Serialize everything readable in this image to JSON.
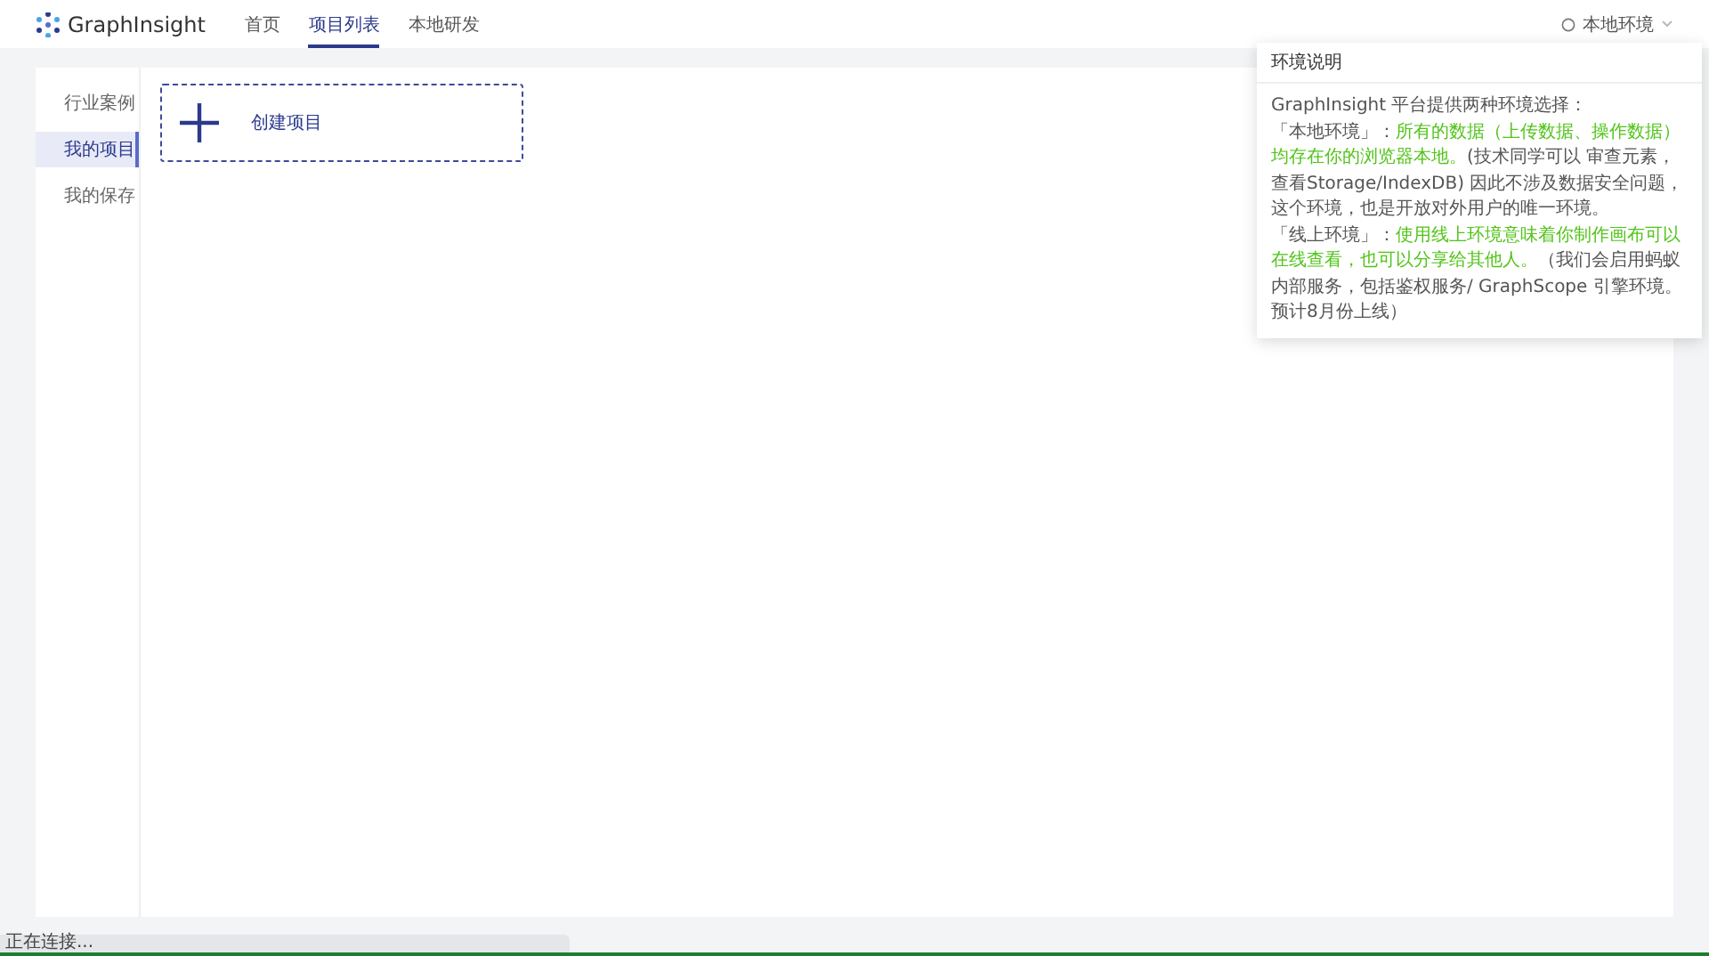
{
  "header": {
    "logo": "GraphInsight",
    "nav": [
      {
        "label": "首页",
        "selected": false
      },
      {
        "label": "项目列表",
        "selected": true
      },
      {
        "label": "本地研发",
        "selected": false
      }
    ],
    "env_select": "本地环境"
  },
  "sidebar": {
    "items": [
      {
        "label": "行业案例",
        "selected": false
      },
      {
        "label": "我的项目",
        "selected": true
      },
      {
        "label": "我的保存",
        "selected": false
      }
    ]
  },
  "create_card": {
    "label": "创建项目"
  },
  "popover": {
    "title": "环境说明",
    "paragraphs": [
      [
        {
          "kind": "normal",
          "text": "GraphInsight 平台提供两种环境选择："
        }
      ],
      [
        {
          "kind": "normal",
          "text": "「本地环境」："
        },
        {
          "kind": "highlight",
          "text": "所有的数据（上传数据、操作数据）均存在你的浏览器本地。"
        },
        {
          "kind": "normal",
          "text": "(技术同学可以 审查元素，查看Storage/IndexDB) 因此不涉及数据安全问题，这个环境，也是开放对外用户的唯一环境。"
        }
      ],
      [
        {
          "kind": "normal",
          "text": "「线上环境」："
        },
        {
          "kind": "highlight",
          "text": "使用线上环境意味着你制作画布可以在线查看，也可以分享给其他人。"
        },
        {
          "kind": "normal",
          "text": "（我们会启用蚂蚁内部服务，包括鉴权服务/ GraphScope 引擎环境。预计8月份上线）"
        }
      ]
    ]
  },
  "status_bar": "正在连接..."
}
